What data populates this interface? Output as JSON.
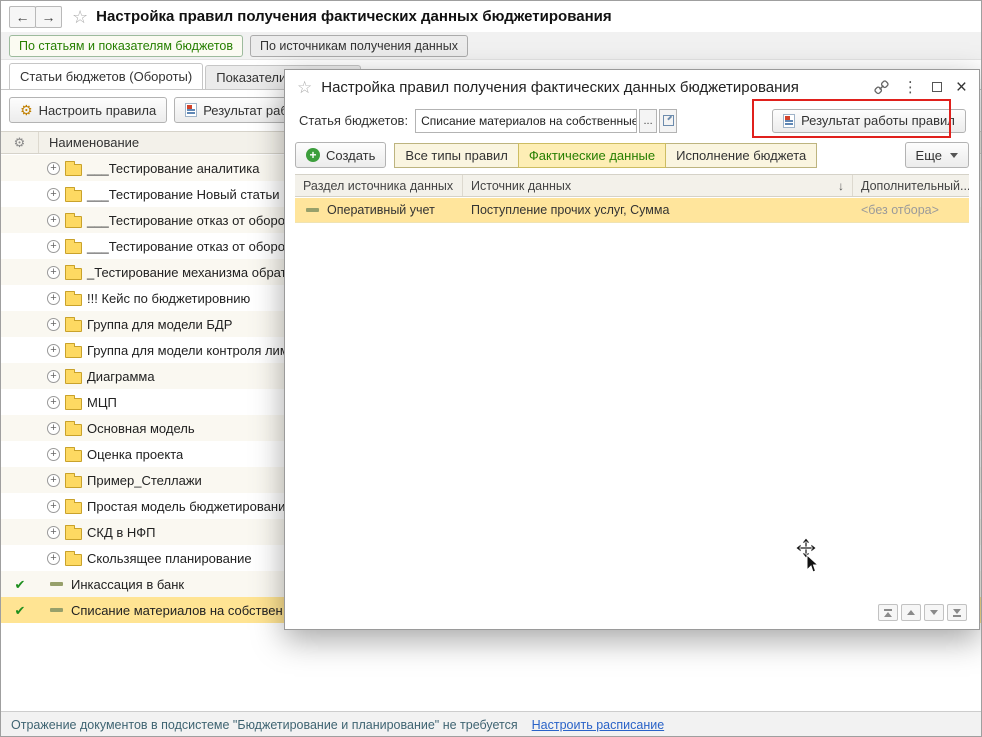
{
  "window": {
    "title": "Настройка правил получения фактических данных бюджетирования"
  },
  "view_switch": {
    "items": [
      {
        "label": "По статьям и показателям бюджетов"
      },
      {
        "label": "По источникам получения данных"
      }
    ]
  },
  "left_panel": {
    "tabs": [
      {
        "label": "Статьи бюджетов (Обороты)"
      },
      {
        "label": "Показатели бюджетов"
      }
    ],
    "toolbar": {
      "configure": "Настроить правила",
      "result": "Результат работы правил"
    },
    "grid": {
      "name_column": "Наименование",
      "rows": [
        {
          "label": "___Тестирование аналитика",
          "type": "folder"
        },
        {
          "label": "___Тестирование Новый статьи в р",
          "type": "folder"
        },
        {
          "label": "___Тестирование отказ от оборотны",
          "type": "folder"
        },
        {
          "label": "___Тестирование отказ от оборотны",
          "type": "folder"
        },
        {
          "label": "_Тестирование механизма обратной",
          "type": "folder"
        },
        {
          "label": "!!! Кейс по бюджетировнию",
          "type": "folder"
        },
        {
          "label": "Группа для модели БДР",
          "type": "folder"
        },
        {
          "label": "Группа для модели контроля лимит",
          "type": "folder"
        },
        {
          "label": "Диаграмма",
          "type": "folder"
        },
        {
          "label": "МЦП",
          "type": "folder"
        },
        {
          "label": "Основная модель",
          "type": "folder"
        },
        {
          "label": "Оценка проекта",
          "type": "folder"
        },
        {
          "label": "Пример_Стеллажи",
          "type": "folder"
        },
        {
          "label": "Простая модель бюджетирования",
          "type": "folder"
        },
        {
          "label": "СКД в НФП",
          "type": "folder"
        },
        {
          "label": "Скользящее планирование",
          "type": "folder"
        },
        {
          "label": "Инкассация в банк",
          "type": "item",
          "checked": true
        },
        {
          "label": "Списание материалов на собствен",
          "type": "item",
          "checked": true,
          "selected": true
        }
      ]
    }
  },
  "dialog": {
    "title": "Настройка правил получения фактических данных бюджетирования",
    "field": {
      "label": "Статья бюджетов:",
      "value": "Списание материалов на собственные нужды",
      "ellipsis": "..."
    },
    "result_button": "Результат работы правил",
    "create_button": "Создать",
    "filter_tabs": [
      {
        "label": "Все типы правил",
        "selected": false
      },
      {
        "label": "Фактические данные",
        "selected": true
      },
      {
        "label": "Исполнение бюджета",
        "selected": false
      }
    ],
    "more_button": "Еще",
    "table": {
      "columns": [
        {
          "label": "Раздел источника данных"
        },
        {
          "label": "Источник данных",
          "sorted": "desc"
        },
        {
          "label": "Дополнительный..."
        }
      ],
      "rows": [
        {
          "section": "Оперативный учет",
          "source": "Поступление прочих услуг, Сумма",
          "extra": "<без отбора>"
        }
      ]
    }
  },
  "footer": {
    "status": "Отражение документов в подсистеме \"Бюджетирование и планирование\" не требуется",
    "link": "Настроить расписание"
  },
  "icons": {
    "back": "←",
    "forward": "→",
    "favorite_star": "☆",
    "gear": "⚙",
    "sort_desc": "↓",
    "dots": "⋮",
    "close": "×",
    "check": "✔",
    "plus": "+"
  },
  "colors": {
    "accent_green": "#267f00",
    "selection_yellow": "#ffe493",
    "annotation_red": "#e0201c"
  }
}
